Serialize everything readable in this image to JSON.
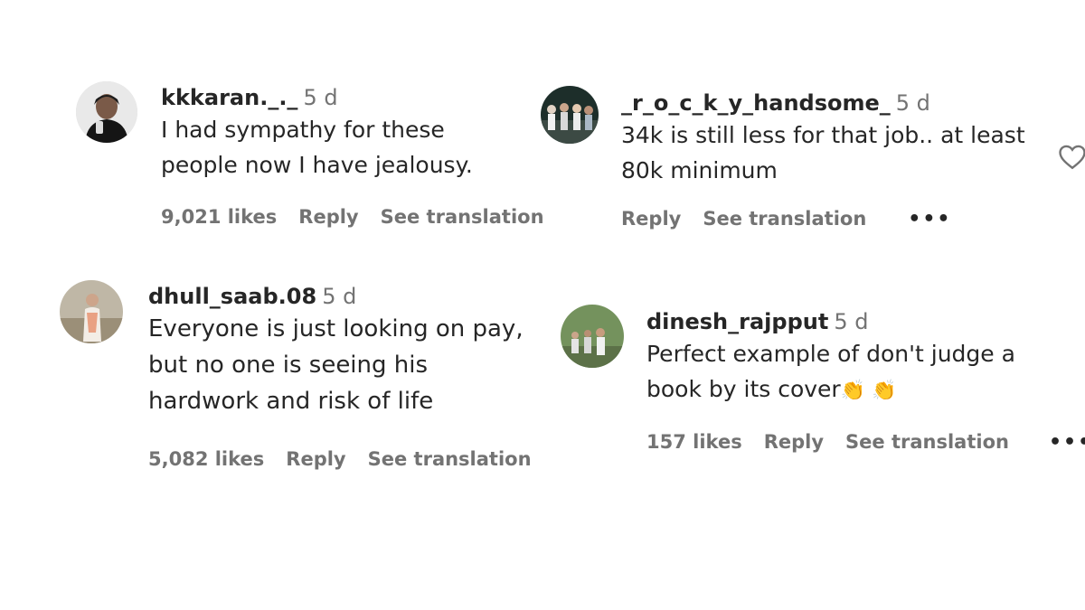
{
  "comments": [
    {
      "username": "kkkaran._._",
      "time": "5 d",
      "lines": [
        "I had sympathy for these",
        "people now I have jealousy."
      ],
      "likes": "9,021 likes",
      "reply": "Reply",
      "translate": "See translation",
      "more": ""
    },
    {
      "username": "_r_o_c_k_y_handsome_",
      "time": "5 d",
      "lines": [
        "34k is still less for that job.. at least",
        "80k minimum"
      ],
      "likes": "",
      "reply": "Reply",
      "translate": "See translation",
      "more": "•••"
    },
    {
      "username": "dhull_saab.08",
      "time": "5 d",
      "lines": [
        "Everyone is just looking on pay,",
        "but no one is seeing his",
        "hardwork and risk of life"
      ],
      "likes": "5,082 likes",
      "reply": "Reply",
      "translate": "See translation",
      "more": ""
    },
    {
      "username": "dinesh_rajpput",
      "time": "5 d",
      "lines": [
        "Perfect example of don't judge a",
        "book by its cover"
      ],
      "emoji": "👏 👏",
      "likes": "157 likes",
      "reply": "Reply",
      "translate": "See translation",
      "more": "•••"
    }
  ],
  "icons": {
    "like": "heart-outline-icon",
    "more": "more-options-icon"
  },
  "colors": {
    "text": "#262626",
    "secondary": "#737373",
    "background": "#ffffff"
  }
}
